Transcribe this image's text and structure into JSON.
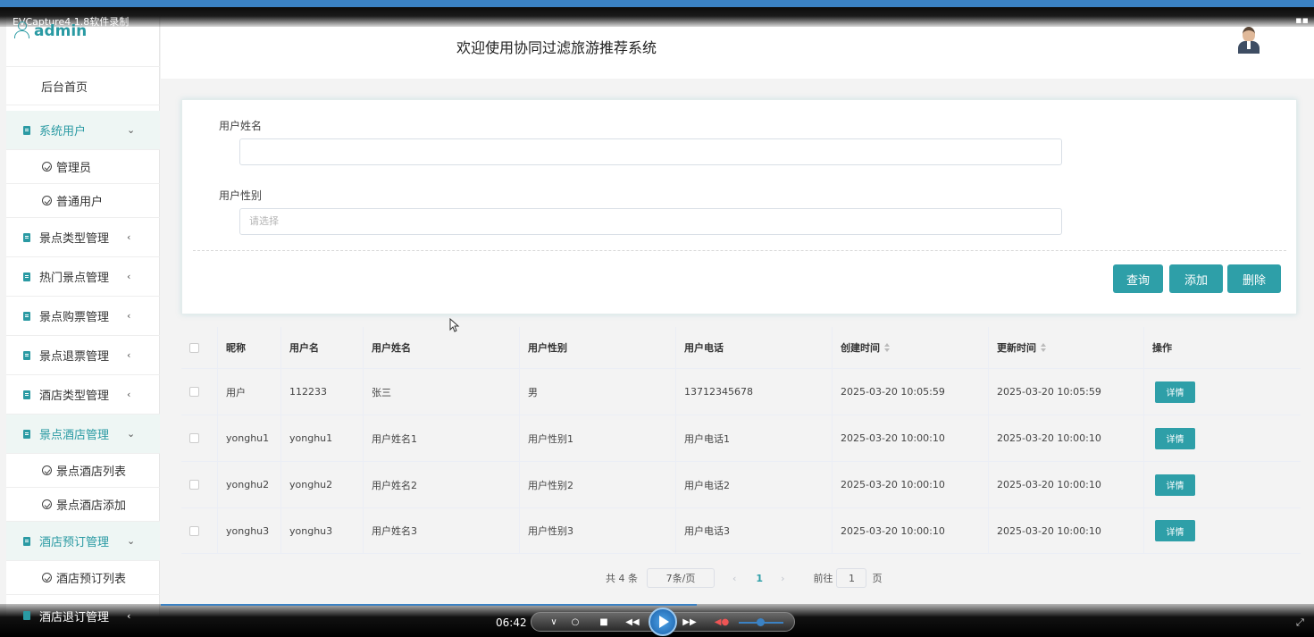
{
  "capture": {
    "title": "EVCapture4.1.8软件录制"
  },
  "header": {
    "welcome": "欢迎使用协同过滤旅游推荐系统"
  },
  "user": {
    "name": "admin"
  },
  "sidebar": {
    "items": [
      {
        "label": "后台首页"
      },
      {
        "label": "系统用户",
        "chevron": "⌄"
      },
      {
        "label": "管理员"
      },
      {
        "label": "普通用户"
      },
      {
        "label": "景点类型管理",
        "chevron": "‹"
      },
      {
        "label": "热门景点管理",
        "chevron": "‹"
      },
      {
        "label": "景点购票管理",
        "chevron": "‹"
      },
      {
        "label": "景点退票管理",
        "chevron": "‹"
      },
      {
        "label": "酒店类型管理",
        "chevron": "‹"
      },
      {
        "label": "景点酒店管理",
        "chevron": "⌄"
      },
      {
        "label": "景点酒店列表"
      },
      {
        "label": "景点酒店添加"
      },
      {
        "label": "酒店预订管理",
        "chevron": "⌄"
      },
      {
        "label": "酒店预订列表"
      },
      {
        "label": "酒店退订管理",
        "chevron": "‹"
      }
    ]
  },
  "search": {
    "name_label": "用户姓名",
    "name_value": "",
    "gender_label": "用户性别",
    "gender_placeholder": "请选择",
    "query_button": "查询",
    "add_button": "添加",
    "delete_button": "删除"
  },
  "table": {
    "columns": [
      "昵称",
      "用户名",
      "用户姓名",
      "用户性别",
      "用户电话",
      "创建时间",
      "更新时间",
      "操作"
    ],
    "rows": [
      {
        "nickname": "用户",
        "username": "112233",
        "realname": "张三",
        "gender": "男",
        "phone": "13712345678",
        "created": "2025-03-20 10:05:59",
        "updated": "2025-03-20 10:05:59",
        "action": "详情"
      },
      {
        "nickname": "yonghu1",
        "username": "yonghu1",
        "realname": "用户姓名1",
        "gender": "用户性别1",
        "phone": "用户电话1",
        "created": "2025-03-20 10:00:10",
        "updated": "2025-03-20 10:00:10",
        "action": "详情"
      },
      {
        "nickname": "yonghu2",
        "username": "yonghu2",
        "realname": "用户姓名2",
        "gender": "用户性别2",
        "phone": "用户电话2",
        "created": "2025-03-20 10:00:10",
        "updated": "2025-03-20 10:00:10",
        "action": "详情"
      },
      {
        "nickname": "yonghu3",
        "username": "yonghu3",
        "realname": "用户姓名3",
        "gender": "用户性别3",
        "phone": "用户电话3",
        "created": "2025-03-20 10:00:10",
        "updated": "2025-03-20 10:00:10",
        "action": "详情"
      }
    ]
  },
  "pagination": {
    "total": "共 4 条",
    "page_size": "7条/页",
    "prev": "‹",
    "current": "1",
    "next": "›",
    "goto": "前往",
    "goto_value": "1",
    "page_unit": "页"
  },
  "player": {
    "time": "06:42"
  },
  "colors": {
    "accent": "#2e9fa8",
    "sidebar_active_bg": "#eef6f4"
  }
}
